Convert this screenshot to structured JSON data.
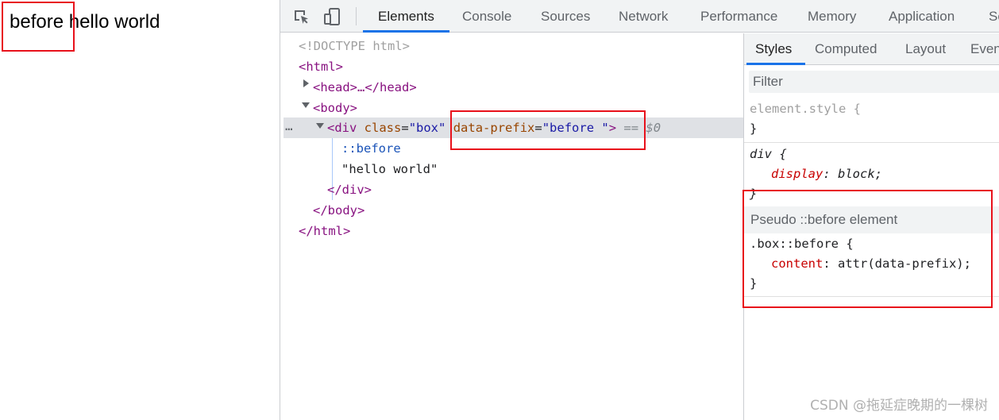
{
  "viewport": {
    "before_text": "before",
    "main_text": " hello world"
  },
  "devtools": {
    "tabs": [
      "Elements",
      "Console",
      "Sources",
      "Network",
      "Performance",
      "Memory",
      "Application",
      "Se"
    ],
    "active_tab": "Elements",
    "tree": {
      "doctype": "<!DOCTYPE html>",
      "html_open": "<html>",
      "head": "<head>…</head>",
      "body_open": "<body>",
      "div_tag_open": "<div",
      "div_class_attr": "class",
      "div_class_val": "\"box\"",
      "div_prefix_attr": "data-prefix",
      "div_prefix_val": "\"before \"",
      "div_tag_close": ">",
      "selected_marker": "== $0",
      "ellipsis": "…",
      "pseudo_before": "::before",
      "text_node": "\"hello world\"",
      "div_close": "</div>",
      "body_close": "</body>",
      "html_close": "</html>"
    },
    "styles_pane": {
      "tabs": [
        "Styles",
        "Computed",
        "Layout",
        "Even"
      ],
      "active_tab": "Styles",
      "filter_placeholder": "Filter",
      "element_style_selector": "element.style {",
      "close_brace": "}",
      "div_selector": "div {",
      "div_prop": "display",
      "div_value": "block;",
      "pseudo_header": "Pseudo ::before element",
      "pseudo_selector": ".box::before {",
      "pseudo_prop": "content",
      "pseudo_value": "attr(data-prefix);"
    }
  },
  "watermark": "CSDN @拖延症晚期的一棵树",
  "colors": {
    "highlight_box": "#e8111b",
    "accent": "#1a73e8",
    "tag": "#881280",
    "attr_name": "#994500",
    "attr_value": "#1a1aa6",
    "css_property": "#c80000"
  }
}
